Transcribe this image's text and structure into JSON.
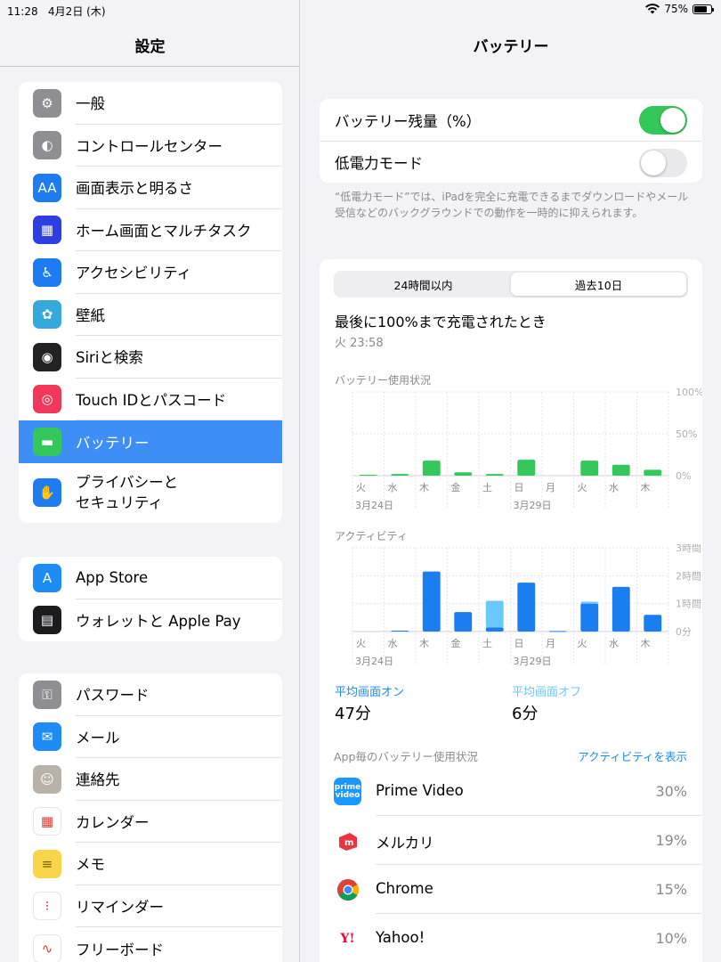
{
  "status": {
    "time": "11:28",
    "date": "4月2日 (木)",
    "battery": "75%",
    "battery_level": 0.75
  },
  "left": {
    "title": "設定",
    "groups": [
      [
        {
          "label": "一般",
          "icon": "gear-icon",
          "color": "#8e8e93",
          "glyph": "⚙"
        },
        {
          "label": "コントロールセンター",
          "icon": "control-center-icon",
          "color": "#8e8e93",
          "glyph": "◐"
        },
        {
          "label": "画面表示と明るさ",
          "icon": "display-icon",
          "color": "#1e7cf2",
          "glyph": "AA"
        },
        {
          "label": "ホーム画面とマルチタスク",
          "icon": "home-screen-icon",
          "color": "#2f3ee0",
          "glyph": "▦"
        },
        {
          "label": "アクセシビリティ",
          "icon": "accessibility-icon",
          "color": "#1e7cf2",
          "glyph": "♿"
        },
        {
          "label": "壁紙",
          "icon": "wallpaper-icon",
          "color": "#34aadc",
          "glyph": "✿"
        },
        {
          "label": "Siriと検索",
          "icon": "siri-icon",
          "color": "#222",
          "glyph": "◉"
        },
        {
          "label": "Touch IDとパスコード",
          "icon": "fingerprint-icon",
          "color": "#f2385a",
          "glyph": "◎"
        },
        {
          "label": "バッテリー",
          "icon": "battery-icon",
          "color": "#34c759",
          "glyph": "▬",
          "selected": true
        },
        {
          "label": "プライバシーと\nセキュリティ",
          "icon": "privacy-hand-icon",
          "color": "#1e7cf2",
          "glyph": "✋",
          "tall": true
        }
      ],
      [
        {
          "label": "App Store",
          "icon": "app-store-icon",
          "color": "#1e8cf5",
          "glyph": "A"
        },
        {
          "label": "ウォレットと Apple Pay",
          "icon": "wallet-icon",
          "color": "#1c1c1e",
          "glyph": "▤"
        }
      ],
      [
        {
          "label": "パスワード",
          "icon": "key-icon",
          "color": "#8e8e93",
          "glyph": "⚿"
        },
        {
          "label": "メール",
          "icon": "mail-icon",
          "color": "#1e8cf5",
          "glyph": "✉"
        },
        {
          "label": "連絡先",
          "icon": "contacts-icon",
          "color": "#b9b2a8",
          "glyph": "☺"
        },
        {
          "label": "カレンダー",
          "icon": "calendar-icon",
          "color": "#ffffff",
          "glyph": "▦"
        },
        {
          "label": "メモ",
          "icon": "notes-icon",
          "color": "#f8d54a",
          "glyph": "≡"
        },
        {
          "label": "リマインダー",
          "icon": "reminders-icon",
          "color": "#ffffff",
          "glyph": "⁝"
        },
        {
          "label": "フリーボード",
          "icon": "freeform-icon",
          "color": "#ffffff",
          "glyph": "∿"
        }
      ]
    ]
  },
  "right": {
    "title": "バッテリー",
    "toggles": [
      {
        "label": "バッテリー残量（%）",
        "on": true
      },
      {
        "label": "低電力モード",
        "on": false
      }
    ],
    "footnote": "“低電力モード”では、iPadを完全に充電できるまでダウンロードやメール受信などのバックグラウンドでの動作を一時的に抑えられます。",
    "segments": [
      "24時間以内",
      "過去10日"
    ],
    "last_charged_title": "最後に100%まで充電されたとき",
    "last_charged_time": "火 23:58",
    "usage_title": "バッテリー使用状況",
    "activity_title": "アクティビティ",
    "avg_on_label": "平均画面オン",
    "avg_on_value": "47分",
    "avg_off_label": "平均画面オフ",
    "avg_off_value": "6分",
    "app_section_title": "App毎のバッテリー使用状況",
    "app_link": "アクティビティを表示",
    "apps": [
      {
        "name": "Prime Video",
        "pct": "30%",
        "icon": "prime-video-icon"
      },
      {
        "name": "メルカリ",
        "pct": "19%",
        "icon": "mercari-icon"
      },
      {
        "name": "Chrome",
        "pct": "15%",
        "icon": "chrome-icon"
      },
      {
        "name": "Yahoo!",
        "pct": "10%",
        "icon": "yahoo-icon"
      }
    ]
  },
  "chart_data": [
    {
      "type": "bar",
      "title": "バッテリー使用状況",
      "categories": [
        "火",
        "水",
        "木",
        "金",
        "土",
        "日",
        "月",
        "火",
        "水",
        "木"
      ],
      "date_labels": [
        {
          "index": 0,
          "text": "3月24日"
        },
        {
          "index": 5,
          "text": "3月29日"
        }
      ],
      "y_ticks": [
        "100%",
        "50%",
        "0%"
      ],
      "ylim": [
        0,
        100
      ],
      "series": [
        {
          "values": [
            1,
            2,
            18,
            4,
            2,
            19,
            0,
            18,
            13,
            7
          ],
          "color": "#34c759"
        }
      ]
    },
    {
      "type": "bar",
      "title": "アクティビティ",
      "categories": [
        "火",
        "水",
        "木",
        "金",
        "土",
        "日",
        "月",
        "火",
        "水",
        "木"
      ],
      "date_labels": [
        {
          "index": 0,
          "text": "3月24日"
        },
        {
          "index": 5,
          "text": "3月29日"
        }
      ],
      "y_ticks": [
        "3時間",
        "2時間",
        "1時間",
        "0分"
      ],
      "ylim": [
        0,
        3
      ],
      "series": [
        {
          "values": [
            0,
            0.03,
            2.15,
            0.7,
            0.15,
            1.75,
            0.02,
            1.0,
            1.6,
            0.6
          ],
          "color": "#1a7ef0"
        },
        {
          "values": [
            0,
            0,
            0,
            0,
            0.95,
            0,
            0,
            0.07,
            0,
            0
          ],
          "color": "#6ac8fa"
        }
      ]
    }
  ]
}
